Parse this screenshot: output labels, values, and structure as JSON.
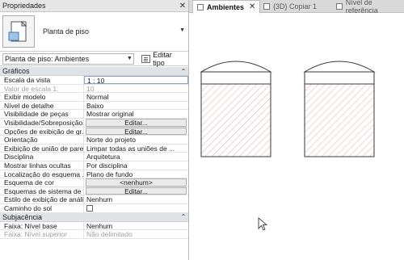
{
  "panel": {
    "title": "Propriedades",
    "close_glyph": "✕",
    "type_name": "Planta de piso",
    "instance_filter": "Planta de piso: Ambientes",
    "edit_type_label": "Editar tipo"
  },
  "groups": {
    "graphics": "Gráficos",
    "underlay": "Subjacência"
  },
  "rows": [
    {
      "label": "Escala da vista",
      "value": "1 : 10"
    },
    {
      "label": "Valor de escala    1:",
      "value": "10"
    },
    {
      "label": "Exibir modelo",
      "value": "Normal"
    },
    {
      "label": "Nível de detalhe",
      "value": "Baixo"
    },
    {
      "label": "Visibilidade de peças",
      "value": "Mostrar original"
    },
    {
      "label": "Visibilidade/Sobreposição...",
      "value": "Editar..."
    },
    {
      "label": "Opções de exibição de gr...",
      "value": "Editar..."
    },
    {
      "label": "Orientação",
      "value": "Norte do projeto"
    },
    {
      "label": "Exibição de união de pare...",
      "value": "Limpar todas as uniões de ..."
    },
    {
      "label": "Disciplina",
      "value": "Arquitetura"
    },
    {
      "label": "Mostrar linhas ocultas",
      "value": "Por disciplina"
    },
    {
      "label": "Localização do esquema ...",
      "value": "Plano de fundo"
    },
    {
      "label": "Esquema de cor",
      "value": "<nenhum>"
    },
    {
      "label": "Esquemas de sistema de c...",
      "value": "Editar..."
    },
    {
      "label": "Estilo de exibição de análi...",
      "value": "Nenhum"
    },
    {
      "label": "Caminho do sol",
      "value": ""
    }
  ],
  "underlay_rows": [
    {
      "label": "Faixa: Nível base",
      "value": "Nenhum"
    },
    {
      "label": "Faixa: Nível superior",
      "value": "Não delimitado"
    }
  ],
  "tabs": [
    {
      "label": "Ambientes",
      "close": "✕"
    },
    {
      "label": "{3D} Copiar 1"
    },
    {
      "label": "Nível de referência"
    }
  ],
  "colors": {
    "hatch": "#e4a1a6",
    "outline": "#3a3a3a"
  }
}
